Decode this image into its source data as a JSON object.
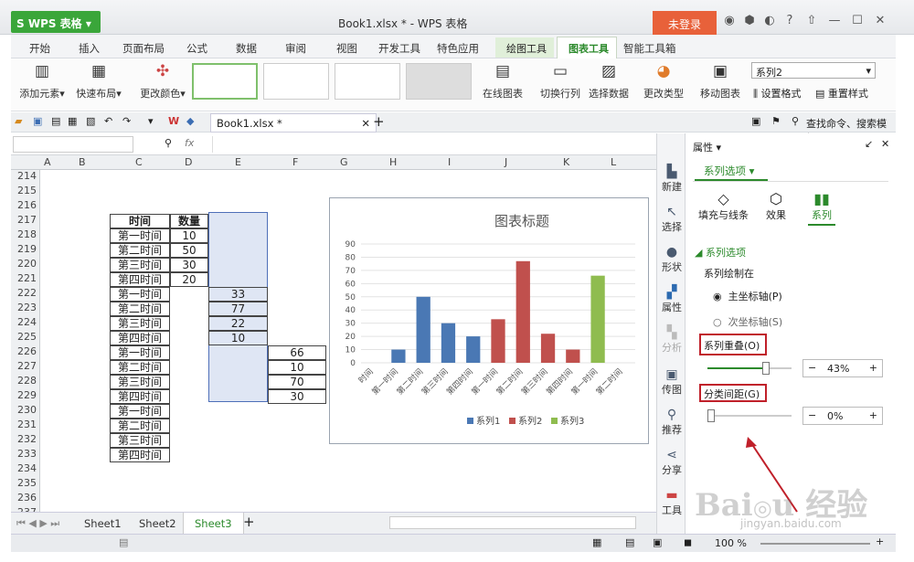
{
  "app": {
    "name": "WPS 表格",
    "doc_title": "Book1.xlsx * - WPS 表格",
    "login": "未登录"
  },
  "tabs": [
    "开始",
    "插入",
    "页面布局",
    "公式",
    "数据",
    "审阅",
    "视图",
    "开发工具",
    "特色应用",
    "绘图工具",
    "图表工具",
    "智能工具箱"
  ],
  "ribbon": {
    "add_element": "添加元素",
    "quick_layout": "快速布局",
    "change_color": "更改颜色",
    "online_chart": "在线图表",
    "switch_rowcol": "切换行列",
    "select_data": "选择数据",
    "change_type": "更改类型",
    "move_chart": "移动图表",
    "series_select": "系列2",
    "set_format": "设置格式",
    "reset_style": "重置样式"
  },
  "quickbar": {
    "file_tab": "Book1.xlsx *",
    "search": "查找命令、搜索模板"
  },
  "formula": {
    "fx": "fx"
  },
  "columns": [
    "A",
    "B",
    "C",
    "D",
    "E",
    "F",
    "G",
    "H",
    "I",
    "J",
    "K",
    "L"
  ],
  "rows": [
    "214",
    "215",
    "216",
    "217",
    "218",
    "219",
    "220",
    "221",
    "222",
    "223",
    "224",
    "225",
    "226",
    "227",
    "228",
    "229",
    "230",
    "231",
    "232",
    "233",
    "234",
    "235",
    "236",
    "237"
  ],
  "table": {
    "h_time": "时间",
    "h_qty": "数量",
    "times": [
      "第一时间",
      "第二时间",
      "第三时间",
      "第四时间"
    ],
    "d": [
      "10",
      "50",
      "30",
      "20"
    ],
    "e": [
      "33",
      "77",
      "22",
      "10"
    ],
    "f": [
      "66",
      "10",
      "70",
      "30"
    ]
  },
  "chart_data": {
    "type": "bar",
    "title": "图表标题",
    "ylim": [
      0,
      90
    ],
    "yticks": [
      "0",
      "10",
      "20",
      "30",
      "40",
      "50",
      "60",
      "70",
      "80",
      "90"
    ],
    "categories": [
      "时间",
      "第一时间",
      "第二时间",
      "第三时间",
      "第四时间",
      "第一时间",
      "第二时间",
      "第三时间",
      "第四时间",
      "第一时间",
      "第二时间"
    ],
    "series": [
      {
        "name": "系列1",
        "color": "#4a78b4",
        "values": [
          0,
          10,
          50,
          30,
          20,
          0,
          0,
          0,
          0,
          0,
          0
        ]
      },
      {
        "name": "系列2",
        "color": "#c0504d",
        "values": [
          0,
          0,
          0,
          0,
          0,
          33,
          77,
          22,
          10,
          0,
          0
        ]
      },
      {
        "name": "系列3",
        "color": "#8fbc4f",
        "values": [
          0,
          0,
          0,
          0,
          0,
          0,
          0,
          0,
          0,
          66,
          0
        ]
      }
    ],
    "legend": "bottom"
  },
  "sheets": [
    "Sheet1",
    "Sheet2",
    "Sheet3"
  ],
  "side": [
    "新建",
    "选择",
    "形状",
    "属性",
    "分析",
    "传图",
    "推荐",
    "分享",
    "工具"
  ],
  "panel": {
    "title": "属性",
    "tab": "系列选项",
    "sub_tabs": [
      "填充与线条",
      "效果",
      "系列"
    ],
    "section": "系列选项",
    "plot_on": "系列绘制在",
    "primary": "主坐标轴(P)",
    "secondary": "次坐标轴(S)",
    "overlap": "系列重叠(O)",
    "overlap_val": "43%",
    "gap": "分类间距(G)",
    "gap_val": "0%"
  },
  "status": {
    "zoom": "100 %"
  },
  "watermark": "Baidu 经验",
  "watermark_url": "jingyan.baidu.com"
}
